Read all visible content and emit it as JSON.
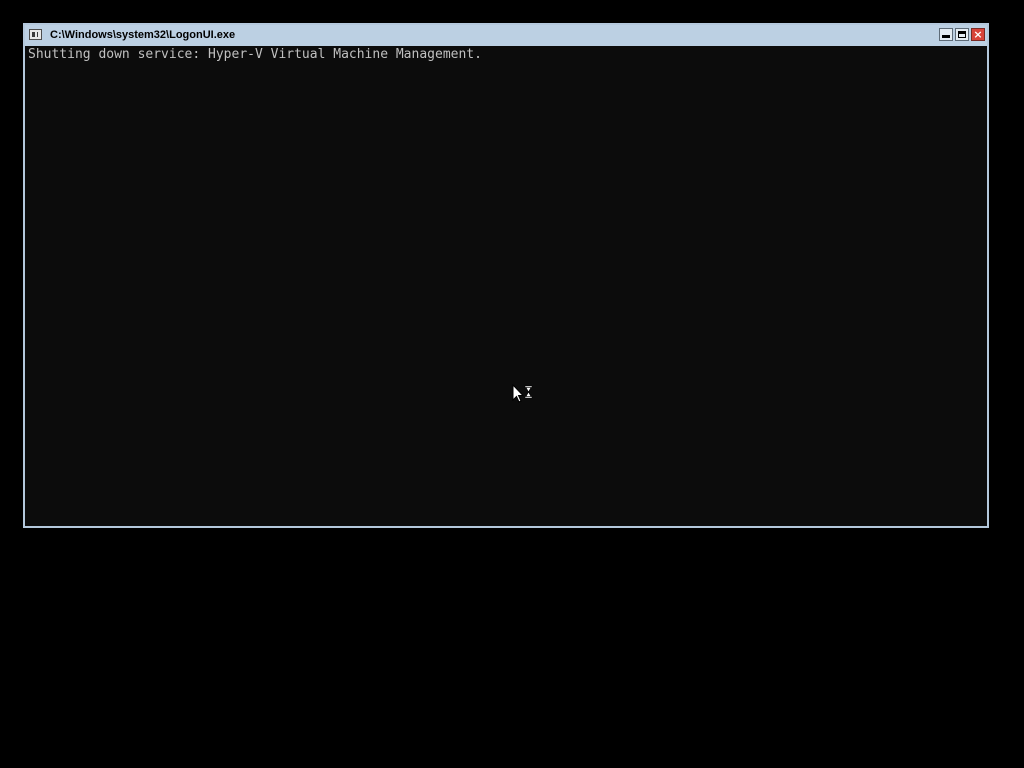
{
  "window": {
    "title": "C:\\Windows\\system32\\LogonUI.exe",
    "icon": "console-app-icon",
    "buttons": {
      "minimize": "minimize-icon",
      "maximize": "maximize-icon",
      "close": "close-icon",
      "close_glyph": "×"
    }
  },
  "console": {
    "lines": [
      "Shutting down service: Hyper-V Virtual Machine Management."
    ]
  },
  "cursor": {
    "icon": "busy-pointer-icon"
  },
  "colors": {
    "desktop_background": "#000000",
    "console_background": "#0c0c0c",
    "console_text": "#c0c0c0",
    "title_bar": "#bcd0e3",
    "close_button": "#d8433a"
  }
}
